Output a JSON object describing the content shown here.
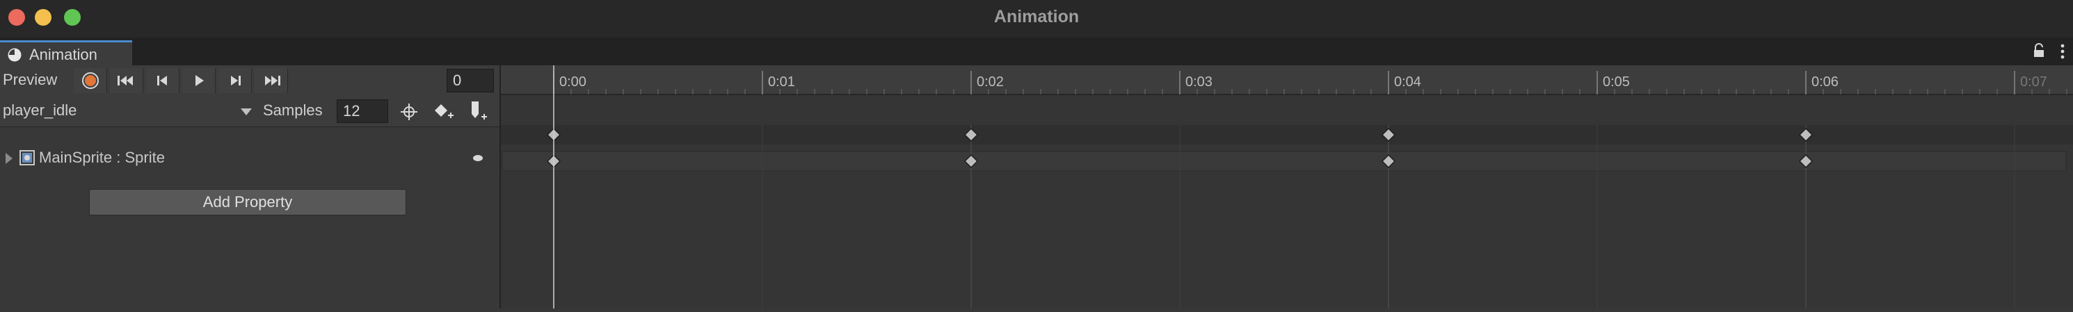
{
  "window": {
    "title": "Animation"
  },
  "tab": {
    "label": "Animation"
  },
  "toolbar": {
    "preview_label": "Preview",
    "frame_value": "0"
  },
  "clip": {
    "name": "player_idle",
    "samples_label": "Samples",
    "samples_value": "12"
  },
  "properties": [
    {
      "label": "MainSprite : Sprite"
    }
  ],
  "add_property_label": "Add Property",
  "timeline": {
    "ruler_labels": [
      "0:00",
      "0:01",
      "0:02",
      "0:03",
      "0:04",
      "0:05",
      "0:06",
      "0:07"
    ],
    "keyframe_frames": [
      0,
      24,
      48,
      72
    ],
    "samples": 12,
    "playhead_frame": 0
  },
  "colors": {
    "record_accent": "#e0763a",
    "playhead": "#cfcfcf",
    "tab_accent": "#4a8bd0"
  },
  "icons": [
    "record-icon",
    "first-key-icon",
    "prev-key-icon",
    "play-icon",
    "next-key-icon",
    "last-key-icon",
    "add-keyframe-icon",
    "add-event-icon",
    "filter-icon",
    "lock-icon",
    "menu-icon",
    "sprite-icon"
  ]
}
